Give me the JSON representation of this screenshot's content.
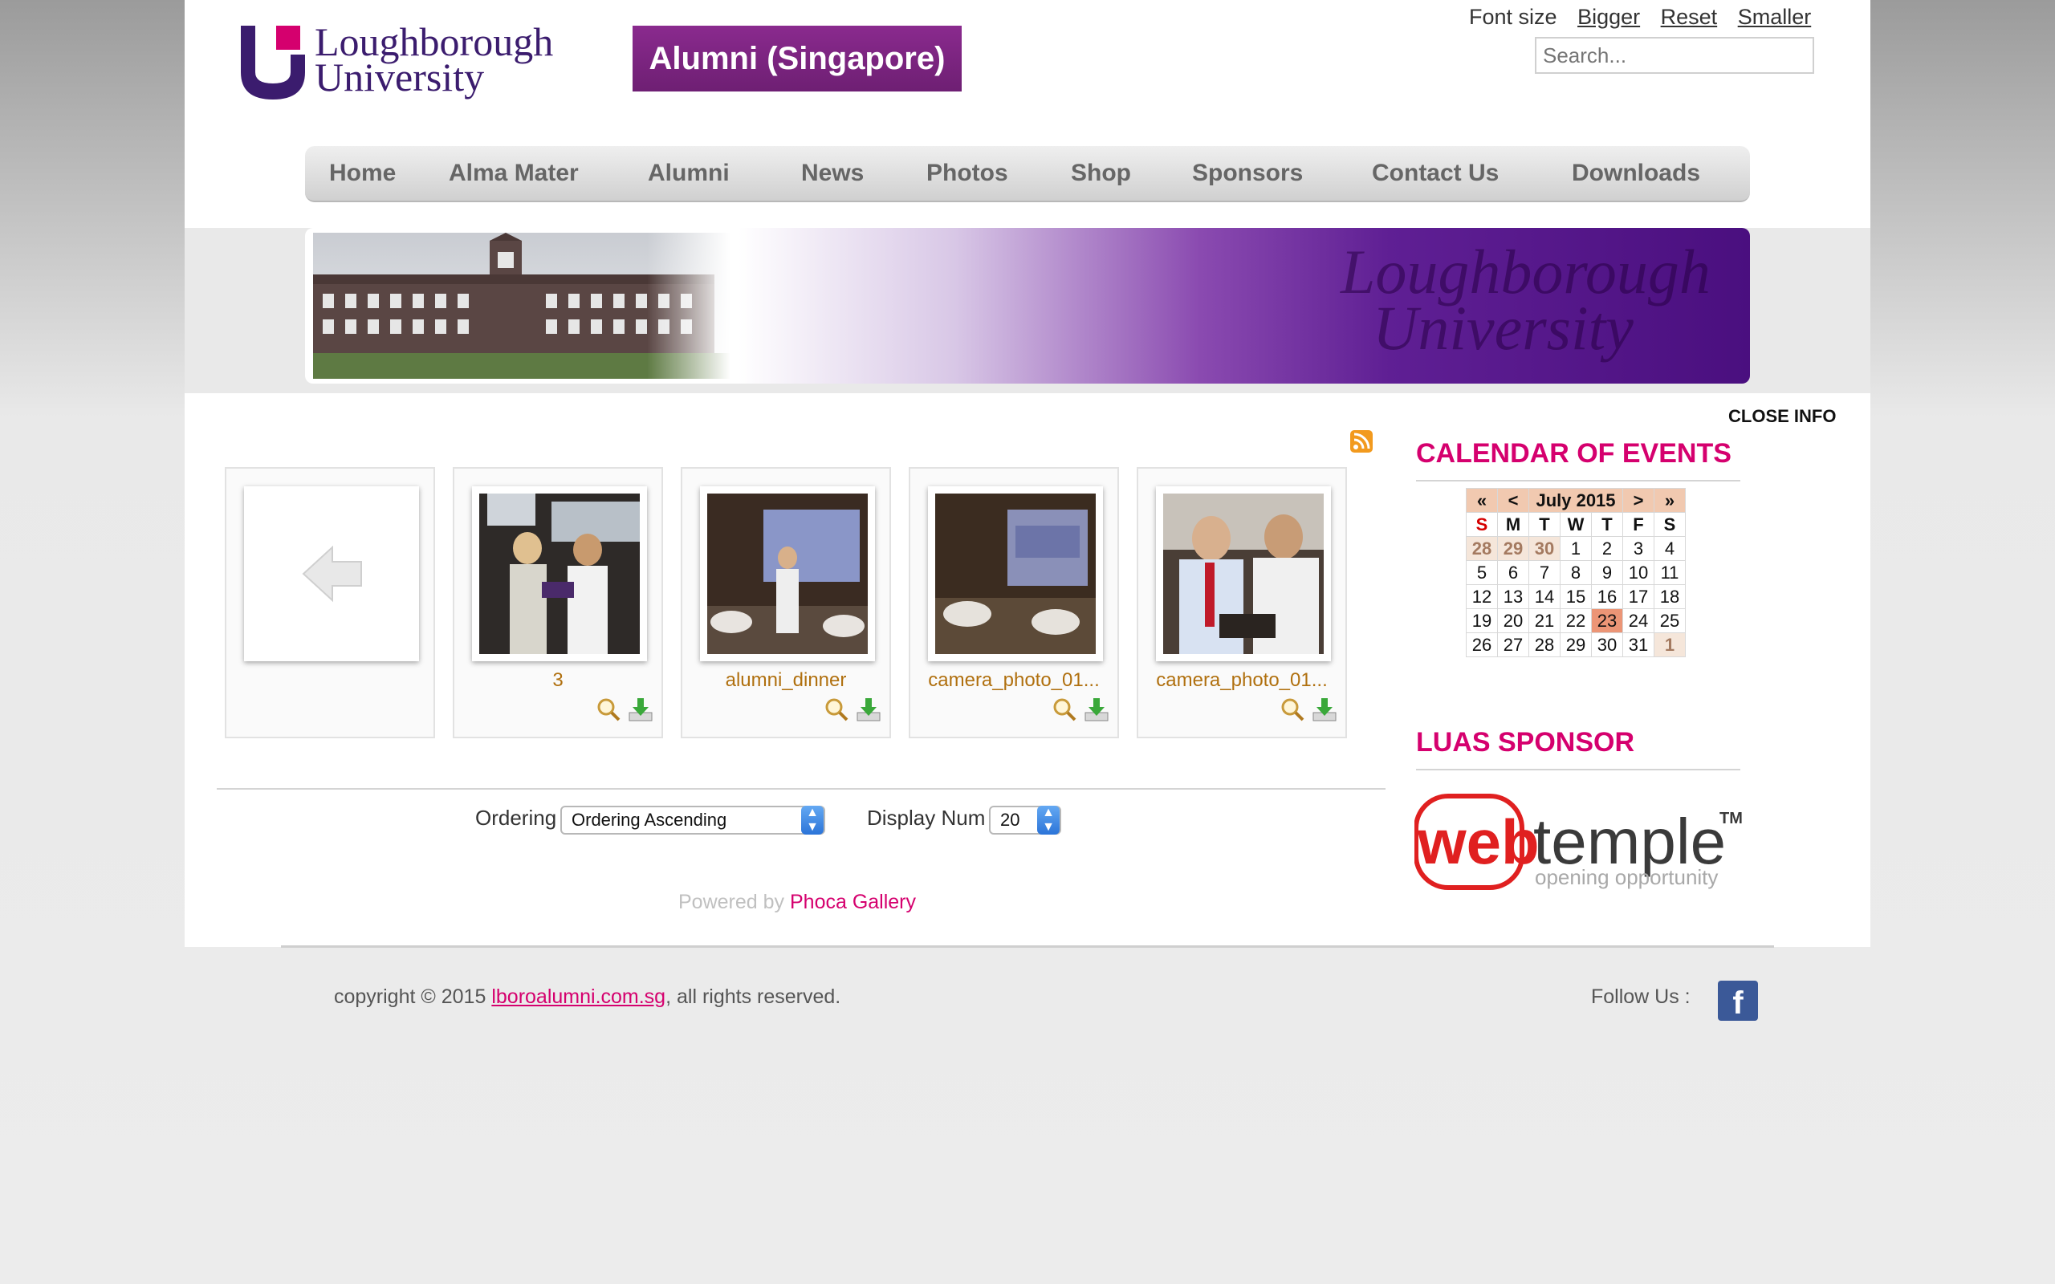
{
  "header": {
    "logo_line1": "Loughborough",
    "logo_line2": "University",
    "banner_text": "Alumni (Singapore)",
    "font_size_label": "Font size",
    "font_bigger": "Bigger",
    "font_reset": "Reset",
    "font_smaller": "Smaller",
    "search_placeholder": "Search..."
  },
  "nav": {
    "items": [
      "Home",
      "Alma Mater",
      "Alumni",
      "News",
      "Photos",
      "Shop",
      "Sponsors",
      "Contact Us",
      "Downloads"
    ]
  },
  "hero": {
    "watermark_line1": "Loughborough",
    "watermark_line2": "University"
  },
  "gallery": {
    "items": [
      {
        "label": "",
        "type": "back"
      },
      {
        "label": "3"
      },
      {
        "label": "alumni_dinner"
      },
      {
        "label": "camera_photo_01..."
      },
      {
        "label": "camera_photo_01..."
      }
    ],
    "ordering_label": "Ordering",
    "ordering_value": "Ordering Ascending",
    "display_num_label": "Display Num",
    "display_num_value": "20",
    "powered_by": "Powered by",
    "powered_link": "Phoca Gallery"
  },
  "sidebar": {
    "close_info": "CLOSE INFO",
    "calendar_title": "CALENDAR OF EVENTS",
    "calendar": {
      "nav_prev_year": "«",
      "nav_prev_month": "<",
      "month": "July 2015",
      "nav_next_month": ">",
      "nav_next_year": "»",
      "day_names": [
        "S",
        "M",
        "T",
        "W",
        "T",
        "F",
        "S"
      ],
      "weeks": [
        [
          "28",
          "29",
          "30",
          "1",
          "2",
          "3",
          "4"
        ],
        [
          "5",
          "6",
          "7",
          "8",
          "9",
          "10",
          "11"
        ],
        [
          "12",
          "13",
          "14",
          "15",
          "16",
          "17",
          "18"
        ],
        [
          "19",
          "20",
          "21",
          "22",
          "23",
          "24",
          "25"
        ],
        [
          "26",
          "27",
          "28",
          "29",
          "30",
          "31",
          "1"
        ]
      ],
      "today": "23"
    },
    "sponsor_title": "LUAS SPONSOR",
    "sponsor_web": "web",
    "sponsor_temple": "temple",
    "sponsor_tm": "TM",
    "sponsor_tagline": "opening opportunity"
  },
  "footer": {
    "copyright_prefix": "copyright © 2015 ",
    "copyright_link": "lboroalumni.com.sg",
    "copyright_suffix": ", all rights reserved.",
    "follow_label": "Follow Us :",
    "facebook_letter": "f"
  },
  "colors": {
    "accent": "#d5006e",
    "purple": "#6e1f73",
    "label_brown": "#b0700f"
  }
}
